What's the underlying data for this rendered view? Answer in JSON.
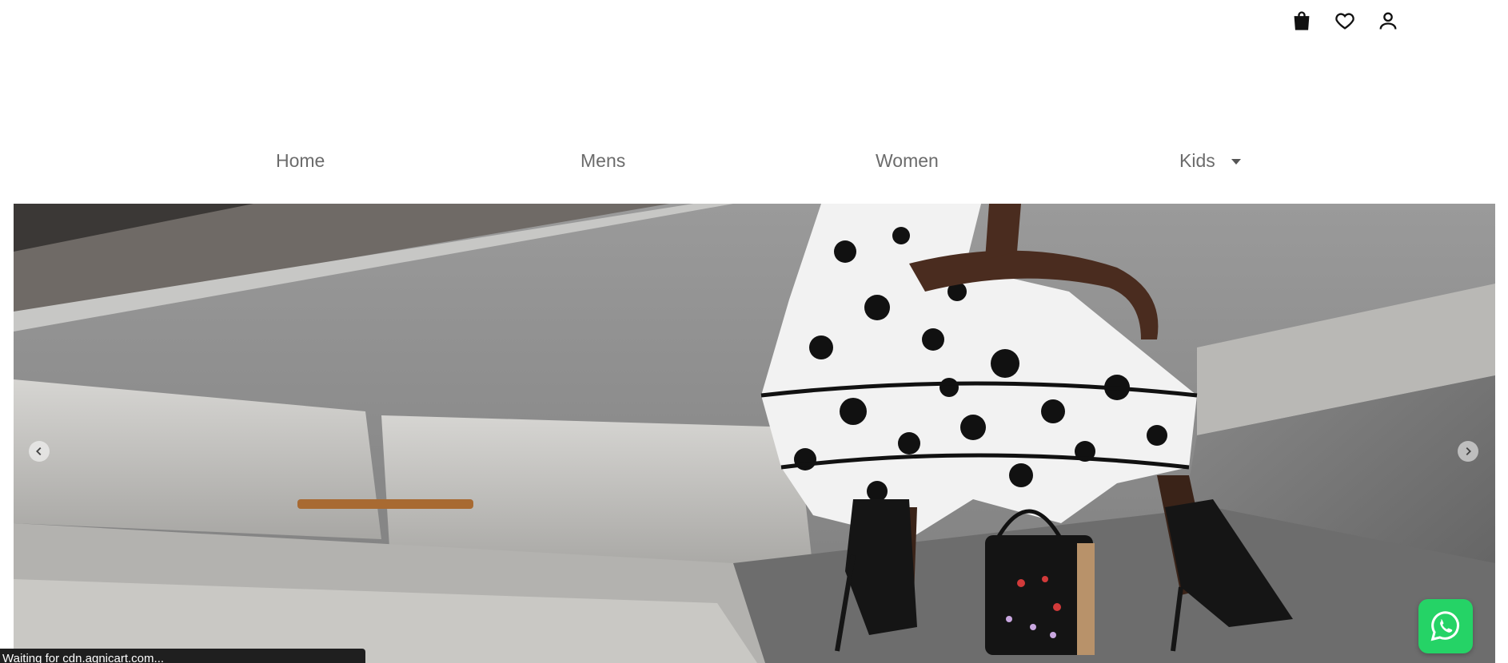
{
  "header": {
    "icons": [
      "shopping-bag-icon",
      "heart-icon",
      "user-icon"
    ]
  },
  "nav": {
    "items": [
      {
        "label": "Home"
      },
      {
        "label": "Mens"
      },
      {
        "label": "Women"
      },
      {
        "label": "Kids",
        "has_dropdown": true
      }
    ]
  },
  "hero": {
    "prev_icon": "chevron-left-icon",
    "next_icon": "chevron-right-icon"
  },
  "whatsapp": {
    "icon": "whatsapp-icon",
    "color": "#25d366"
  },
  "status_bar": {
    "text": "Waiting for cdn.agnicart.com..."
  }
}
